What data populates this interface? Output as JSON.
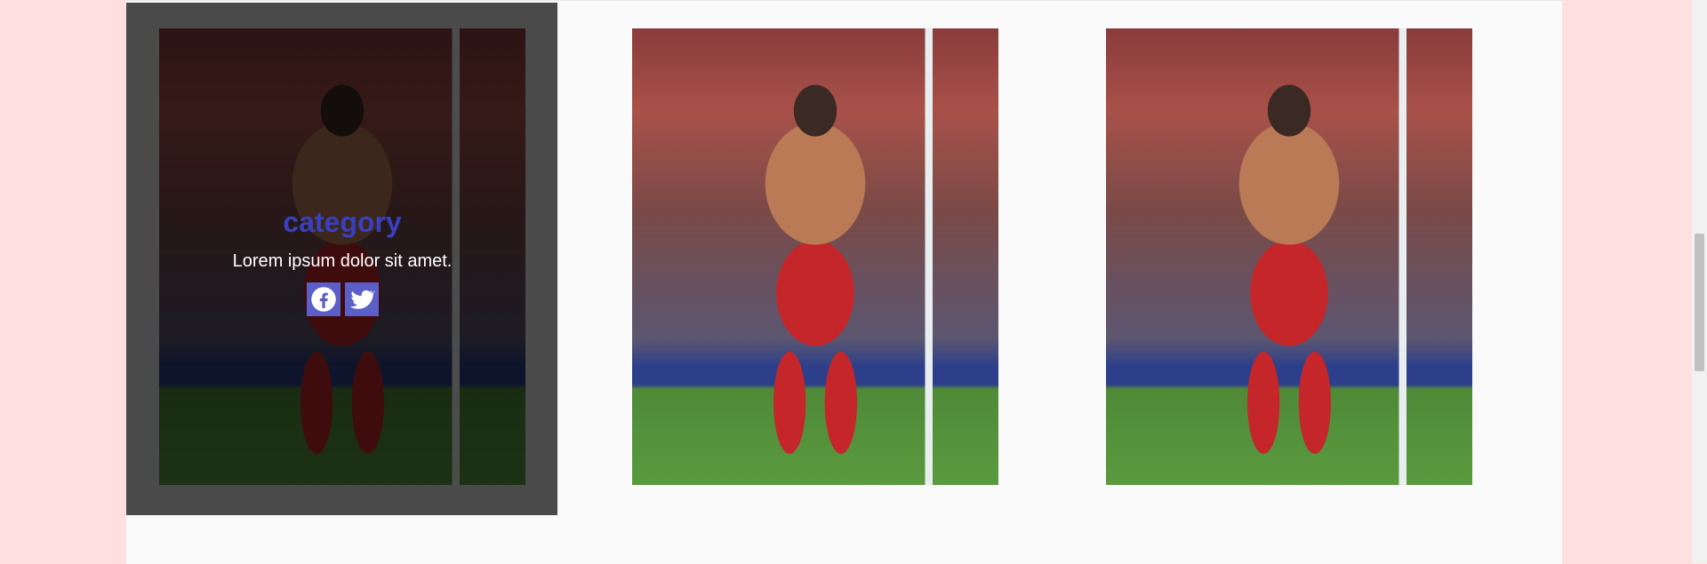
{
  "gallery": {
    "cards": [
      {
        "title": "category",
        "text": "Lorem ipsum dolor sit amet.",
        "hovered": true,
        "social": [
          "facebook-icon",
          "twitter-icon"
        ]
      },
      {
        "hovered": false
      },
      {
        "hovered": false
      }
    ]
  },
  "colors": {
    "page_background": "#ffe0e0",
    "container_background": "#fafafa",
    "hover_frame": "#4a4a4a",
    "title": "#3a3fc0",
    "social_button": "#5b5fc7"
  }
}
